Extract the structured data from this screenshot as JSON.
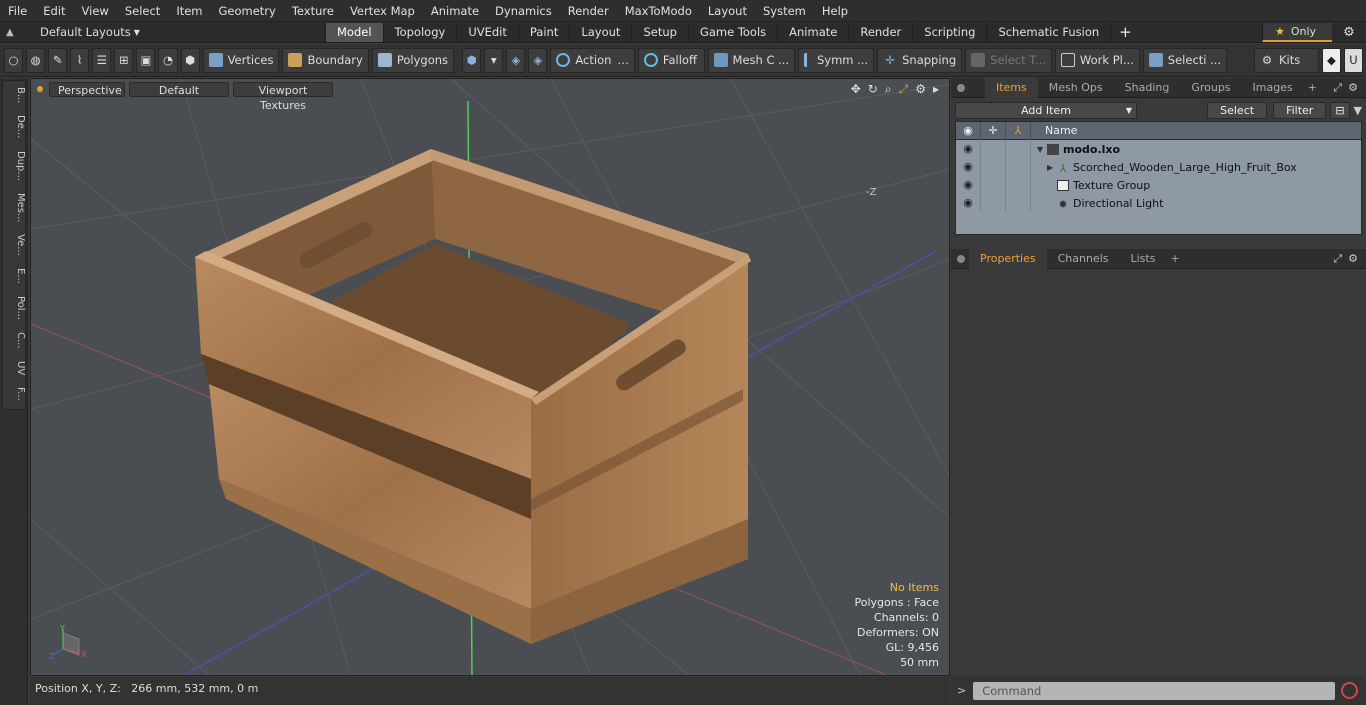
{
  "menu": [
    "File",
    "Edit",
    "View",
    "Select",
    "Item",
    "Geometry",
    "Texture",
    "Vertex Map",
    "Animate",
    "Dynamics",
    "Render",
    "MaxToModo",
    "Layout",
    "System",
    "Help"
  ],
  "layout_selector": {
    "label": "Default Layouts"
  },
  "mode_tabs": [
    {
      "label": "Model",
      "active": true
    },
    {
      "label": "Topology"
    },
    {
      "label": "UVEdit"
    },
    {
      "label": "Paint"
    },
    {
      "label": "Layout"
    },
    {
      "label": "Setup"
    },
    {
      "label": "Game Tools"
    },
    {
      "label": "Animate"
    },
    {
      "label": "Render"
    },
    {
      "label": "Scripting"
    },
    {
      "label": "Schematic Fusion"
    }
  ],
  "only_label": "Only",
  "toolbar": {
    "vertices": "Vertices",
    "boundary": "Boundary",
    "polygons": "Polygons",
    "action": "Action",
    "falloff": "Falloff",
    "mesh": "Mesh C ...",
    "symm": "Symm ...",
    "snapping": "Snapping",
    "select_t": "Select T...",
    "workplane": "Work Pl...",
    "selecti": "Selecti ...",
    "kits": "Kits"
  },
  "left_tabs": [
    "B...",
    "De...",
    "Dup...",
    "Mes...",
    "Ve...",
    "E...",
    "Pol...",
    "C...",
    "UV",
    "F..."
  ],
  "viewport": {
    "view_mode": "Perspective",
    "shading": "Default",
    "textures": "Viewport Textures",
    "axis_label": "-Z",
    "info": {
      "items": "No Items",
      "polygons": "Polygons : Face",
      "channels": "Channels: 0",
      "deformers": "Deformers: ON",
      "gl": "GL: 9,456",
      "scale": "50 mm"
    }
  },
  "status": "Position X, Y, Z:   266 mm, 532 mm, 0 m",
  "right_panel": {
    "top_tabs": [
      {
        "label": "Items",
        "active": true
      },
      {
        "label": "Mesh Ops"
      },
      {
        "label": "Shading"
      },
      {
        "label": "Groups"
      },
      {
        "label": "Images"
      }
    ],
    "add_item": "Add Item",
    "select": "Select",
    "filter": "Filter",
    "name_header": "Name",
    "items": [
      {
        "name": "modo.lxo",
        "bold": true
      },
      {
        "name": "Scorched_Wooden_Large_High_Fruit_Box"
      },
      {
        "name": "Texture Group"
      },
      {
        "name": "Directional Light"
      }
    ],
    "bottom_tabs": [
      {
        "label": "Properties",
        "active": true
      },
      {
        "label": "Channels"
      },
      {
        "label": "Lists"
      }
    ],
    "command_placeholder": "Command"
  },
  "colors": {
    "accent": "#f0a030",
    "viewport_bg": "#4a4d52",
    "wood": "#a57650"
  }
}
